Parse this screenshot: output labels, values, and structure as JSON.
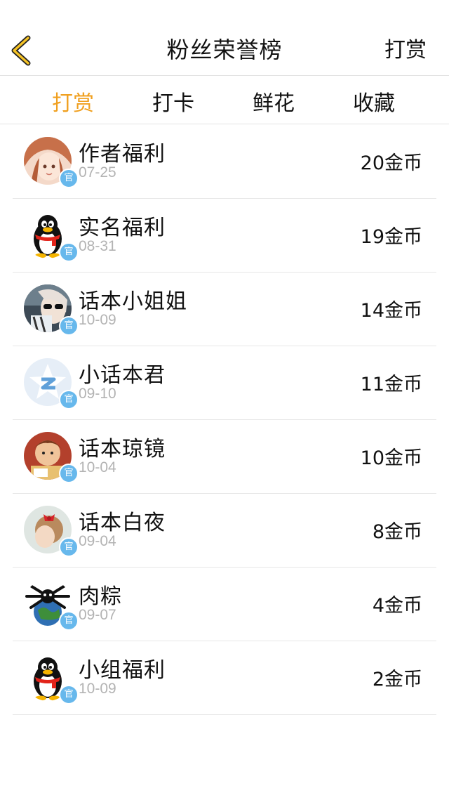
{
  "header": {
    "title": "粉丝荣誉榜",
    "action_label": "打赏",
    "back_icon": "chevron-left-icon",
    "accent_color": "#f0a020"
  },
  "tabs": [
    {
      "label": "打赏",
      "active": true
    },
    {
      "label": "打卡",
      "active": false
    },
    {
      "label": "鲜花",
      "active": false
    },
    {
      "label": "收藏",
      "active": false
    }
  ],
  "badge_text": "官",
  "rows": [
    {
      "name": "作者福利",
      "date": "07-25",
      "amount": "20金币",
      "avatar": "anime-girl-avatar"
    },
    {
      "name": "实名福利",
      "date": "08-31",
      "amount": "19金币",
      "avatar": "penguin-avatar"
    },
    {
      "name": "话本小姐姐",
      "date": "10-09",
      "amount": "14金币",
      "avatar": "sunglasses-girl-avatar"
    },
    {
      "name": "小话本君",
      "date": "09-10",
      "amount": "11金币",
      "avatar": "star-logo-avatar"
    },
    {
      "name": "话本琼镜",
      "date": "10-04",
      "amount": "10金币",
      "avatar": "cartoon-character-avatar"
    },
    {
      "name": "话本白夜",
      "date": "09-04",
      "amount": "8金币",
      "avatar": "red-bow-girl-avatar"
    },
    {
      "name": "肉粽",
      "date": "09-07",
      "amount": "4金币",
      "avatar": "spider-globe-avatar"
    },
    {
      "name": "小组福利",
      "date": "10-09",
      "amount": "2金币",
      "avatar": "penguin-avatar"
    }
  ]
}
